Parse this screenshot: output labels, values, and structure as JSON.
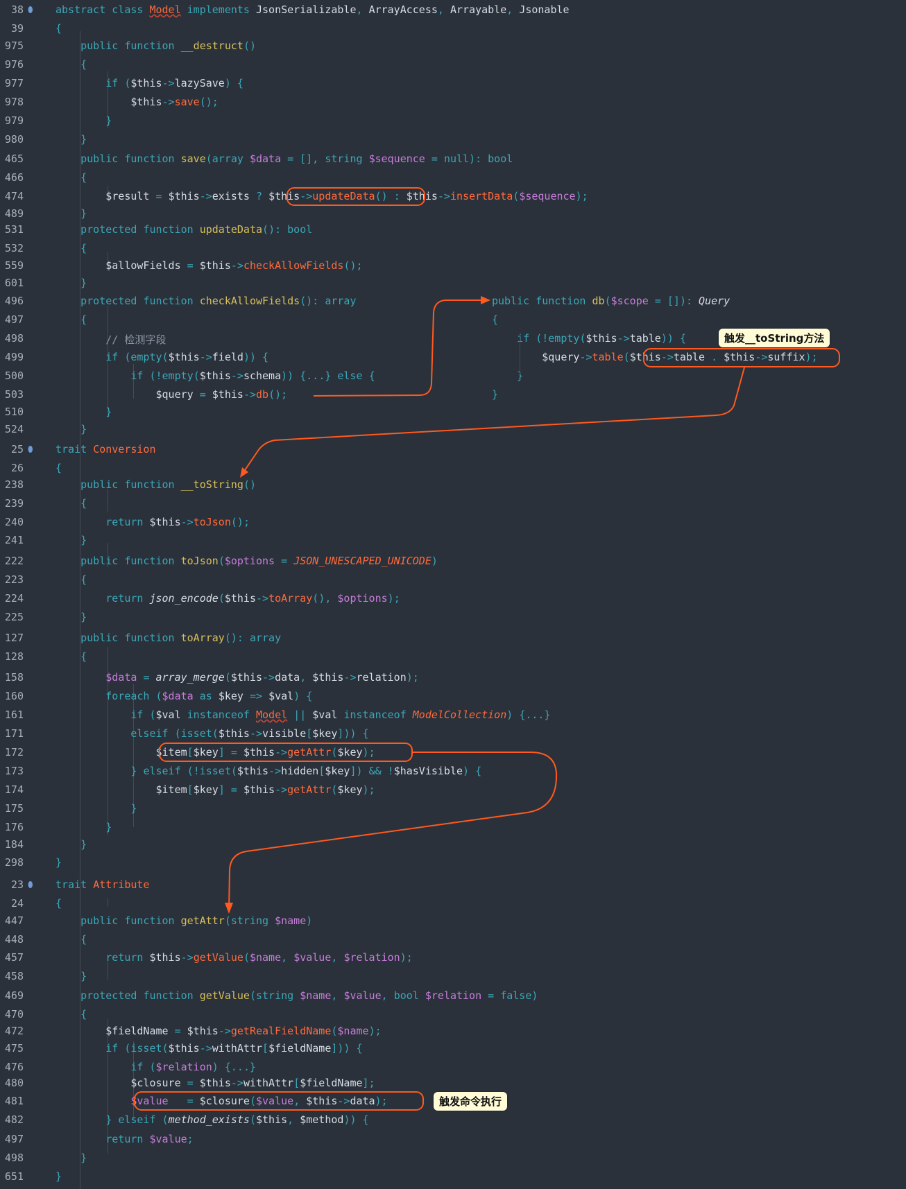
{
  "lines": [
    {
      "n": "38",
      "bm": true,
      "t": "abstract class Model implements JsonSerializable, ArrayAccess, Arrayable, Jsonable"
    },
    {
      "n": "39",
      "t": "{"
    },
    {
      "n": "975",
      "t": "    public function __destruct()"
    },
    {
      "n": "976",
      "t": "    {"
    },
    {
      "n": "977",
      "t": "        if ($this->lazySave) {"
    },
    {
      "n": "978",
      "t": "            $this->save();"
    },
    {
      "n": "979",
      "t": "        }"
    },
    {
      "n": "980",
      "t": "    }"
    },
    {
      "n": "465",
      "t": "    public function save(array $data = [], string $sequence = null): bool"
    },
    {
      "n": "466",
      "t": "    {"
    },
    {
      "n": "474",
      "t": "        $result = $this->exists ? $this->updateData() : $this->insertData($sequence);"
    },
    {
      "n": "489",
      "t": "    }"
    },
    {
      "n": "531",
      "t": "    protected function updateData(): bool"
    },
    {
      "n": "532",
      "t": "    {"
    },
    {
      "n": "559",
      "t": "        $allowFields = $this->checkAllowFields();"
    },
    {
      "n": "601",
      "t": "    }"
    },
    {
      "n": "496",
      "t": "    protected function checkAllowFields(): array"
    },
    {
      "n": "497",
      "t": "    {"
    },
    {
      "n": "498",
      "t": "        // 检测字段"
    },
    {
      "n": "499",
      "t": "        if (empty($this->field)) {"
    },
    {
      "n": "500",
      "t": "            if (!empty($this->schema)) {...} else {"
    },
    {
      "n": "503",
      "t": "                $query = $this->db();"
    },
    {
      "n": "510",
      "t": "        }"
    },
    {
      "n": "524",
      "t": "    }"
    },
    {
      "n": "25",
      "bm": true,
      "t": "trait Conversion"
    },
    {
      "n": "26",
      "t": "{"
    },
    {
      "n": "238",
      "t": "    public function __toString()"
    },
    {
      "n": "239",
      "t": "    {"
    },
    {
      "n": "240",
      "t": "        return $this->toJson();"
    },
    {
      "n": "241",
      "t": "    }"
    },
    {
      "n": "222",
      "t": "    public function toJson($options = JSON_UNESCAPED_UNICODE)"
    },
    {
      "n": "223",
      "t": "    {"
    },
    {
      "n": "224",
      "t": "        return json_encode($this->toArray(), $options);"
    },
    {
      "n": "225",
      "t": "    }"
    },
    {
      "n": "127",
      "t": "    public function toArray(): array"
    },
    {
      "n": "128",
      "t": "    {"
    },
    {
      "n": "158",
      "t": "        $data = array_merge($this->data, $this->relation);"
    },
    {
      "n": "160",
      "t": "        foreach ($data as $key => $val) {"
    },
    {
      "n": "161",
      "t": "            if ($val instanceof Model || $val instanceof ModelCollection) {...}"
    },
    {
      "n": "171",
      "t": "            elseif (isset($this->visible[$key])) {"
    },
    {
      "n": "172",
      "t": "                $item[$key] = $this->getAttr($key);"
    },
    {
      "n": "173",
      "t": "            } elseif (!isset($this->hidden[$key]) && !$hasVisible) {"
    },
    {
      "n": "174",
      "t": "                $item[$key] = $this->getAttr($key);"
    },
    {
      "n": "175",
      "t": "            }"
    },
    {
      "n": "176",
      "t": "        }"
    },
    {
      "n": "184",
      "t": "    }"
    },
    {
      "n": "298",
      "t": "}"
    },
    {
      "n": "23",
      "bm": true,
      "t": "trait Attribute"
    },
    {
      "n": "24",
      "t": "{"
    },
    {
      "n": "447",
      "t": "    public function getAttr(string $name)"
    },
    {
      "n": "448",
      "t": "    {"
    },
    {
      "n": "457",
      "t": "        return $this->getValue($name, $value, $relation);"
    },
    {
      "n": "458",
      "t": "    }"
    },
    {
      "n": "469",
      "t": "    protected function getValue(string $name, $value, bool $relation = false)"
    },
    {
      "n": "470",
      "t": "    {"
    },
    {
      "n": "472",
      "t": "        $fieldName = $this->getRealFieldName($name);"
    },
    {
      "n": "475",
      "t": "        if (isset($this->withAttr[$fieldName])) {"
    },
    {
      "n": "476",
      "t": "            if ($relation) {...}"
    },
    {
      "n": "480",
      "t": "            $closure = $this->withAttr[$fieldName];"
    },
    {
      "n": "481",
      "t": "            $value   = $closure($value, $this->data);"
    },
    {
      "n": "482",
      "t": "        } elseif (method_exists($this, $method)) {"
    },
    {
      "n": "497",
      "t": "        return $value;"
    },
    {
      "n": "498",
      "t": "    }"
    },
    {
      "n": "651",
      "t": "}"
    }
  ],
  "side": [
    {
      "t": "public function db($scope = []): Query"
    },
    {
      "t": "{"
    },
    {
      "t": "    if (!empty($this->table)) {"
    },
    {
      "t": "        $query->table($this->table . $this->suffix);"
    },
    {
      "t": "    }"
    },
    {
      "t": "}"
    }
  ],
  "annotations": {
    "tostring": "触发__toString方法",
    "exec": "触发命令执行"
  },
  "colors": {
    "background": "#2b313a",
    "highlight": "#ff5a1f",
    "tooltip": "#fffbd6",
    "keyword": "#3aa7b8",
    "function": "#d7c05a",
    "method": "#ff6a3d",
    "param": "#c77ddd"
  }
}
